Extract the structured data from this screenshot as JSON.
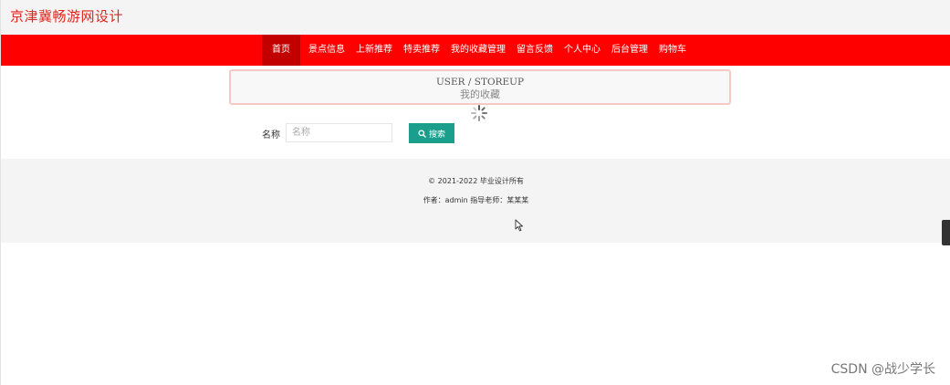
{
  "header": {
    "site_title": "京津冀畅游网设计"
  },
  "nav": {
    "items": [
      {
        "label": "首页",
        "active": true
      },
      {
        "label": "景点信息"
      },
      {
        "label": "上新推荐"
      },
      {
        "label": "特卖推荐"
      },
      {
        "label": "我的收藏管理"
      },
      {
        "label": "留言反馈"
      },
      {
        "label": "个人中心"
      },
      {
        "label": "后台管理"
      },
      {
        "label": "购物车"
      }
    ]
  },
  "breadcrumb": {
    "path_en": "USER / STOREUP",
    "title_cn": "我的收藏"
  },
  "search": {
    "label": "名称",
    "placeholder": "名称",
    "value": "",
    "button_label": "搜索"
  },
  "footer": {
    "copyright": "© 2021-2022 毕业设计所有",
    "author": "作者：admin 指导老师：某某某"
  },
  "watermark": "CSDN @战少学长",
  "colors": {
    "brand_red": "#ff0000",
    "nav_active": "#c30000",
    "title_red": "#e0251c",
    "search_button": "#1b9e8c"
  }
}
